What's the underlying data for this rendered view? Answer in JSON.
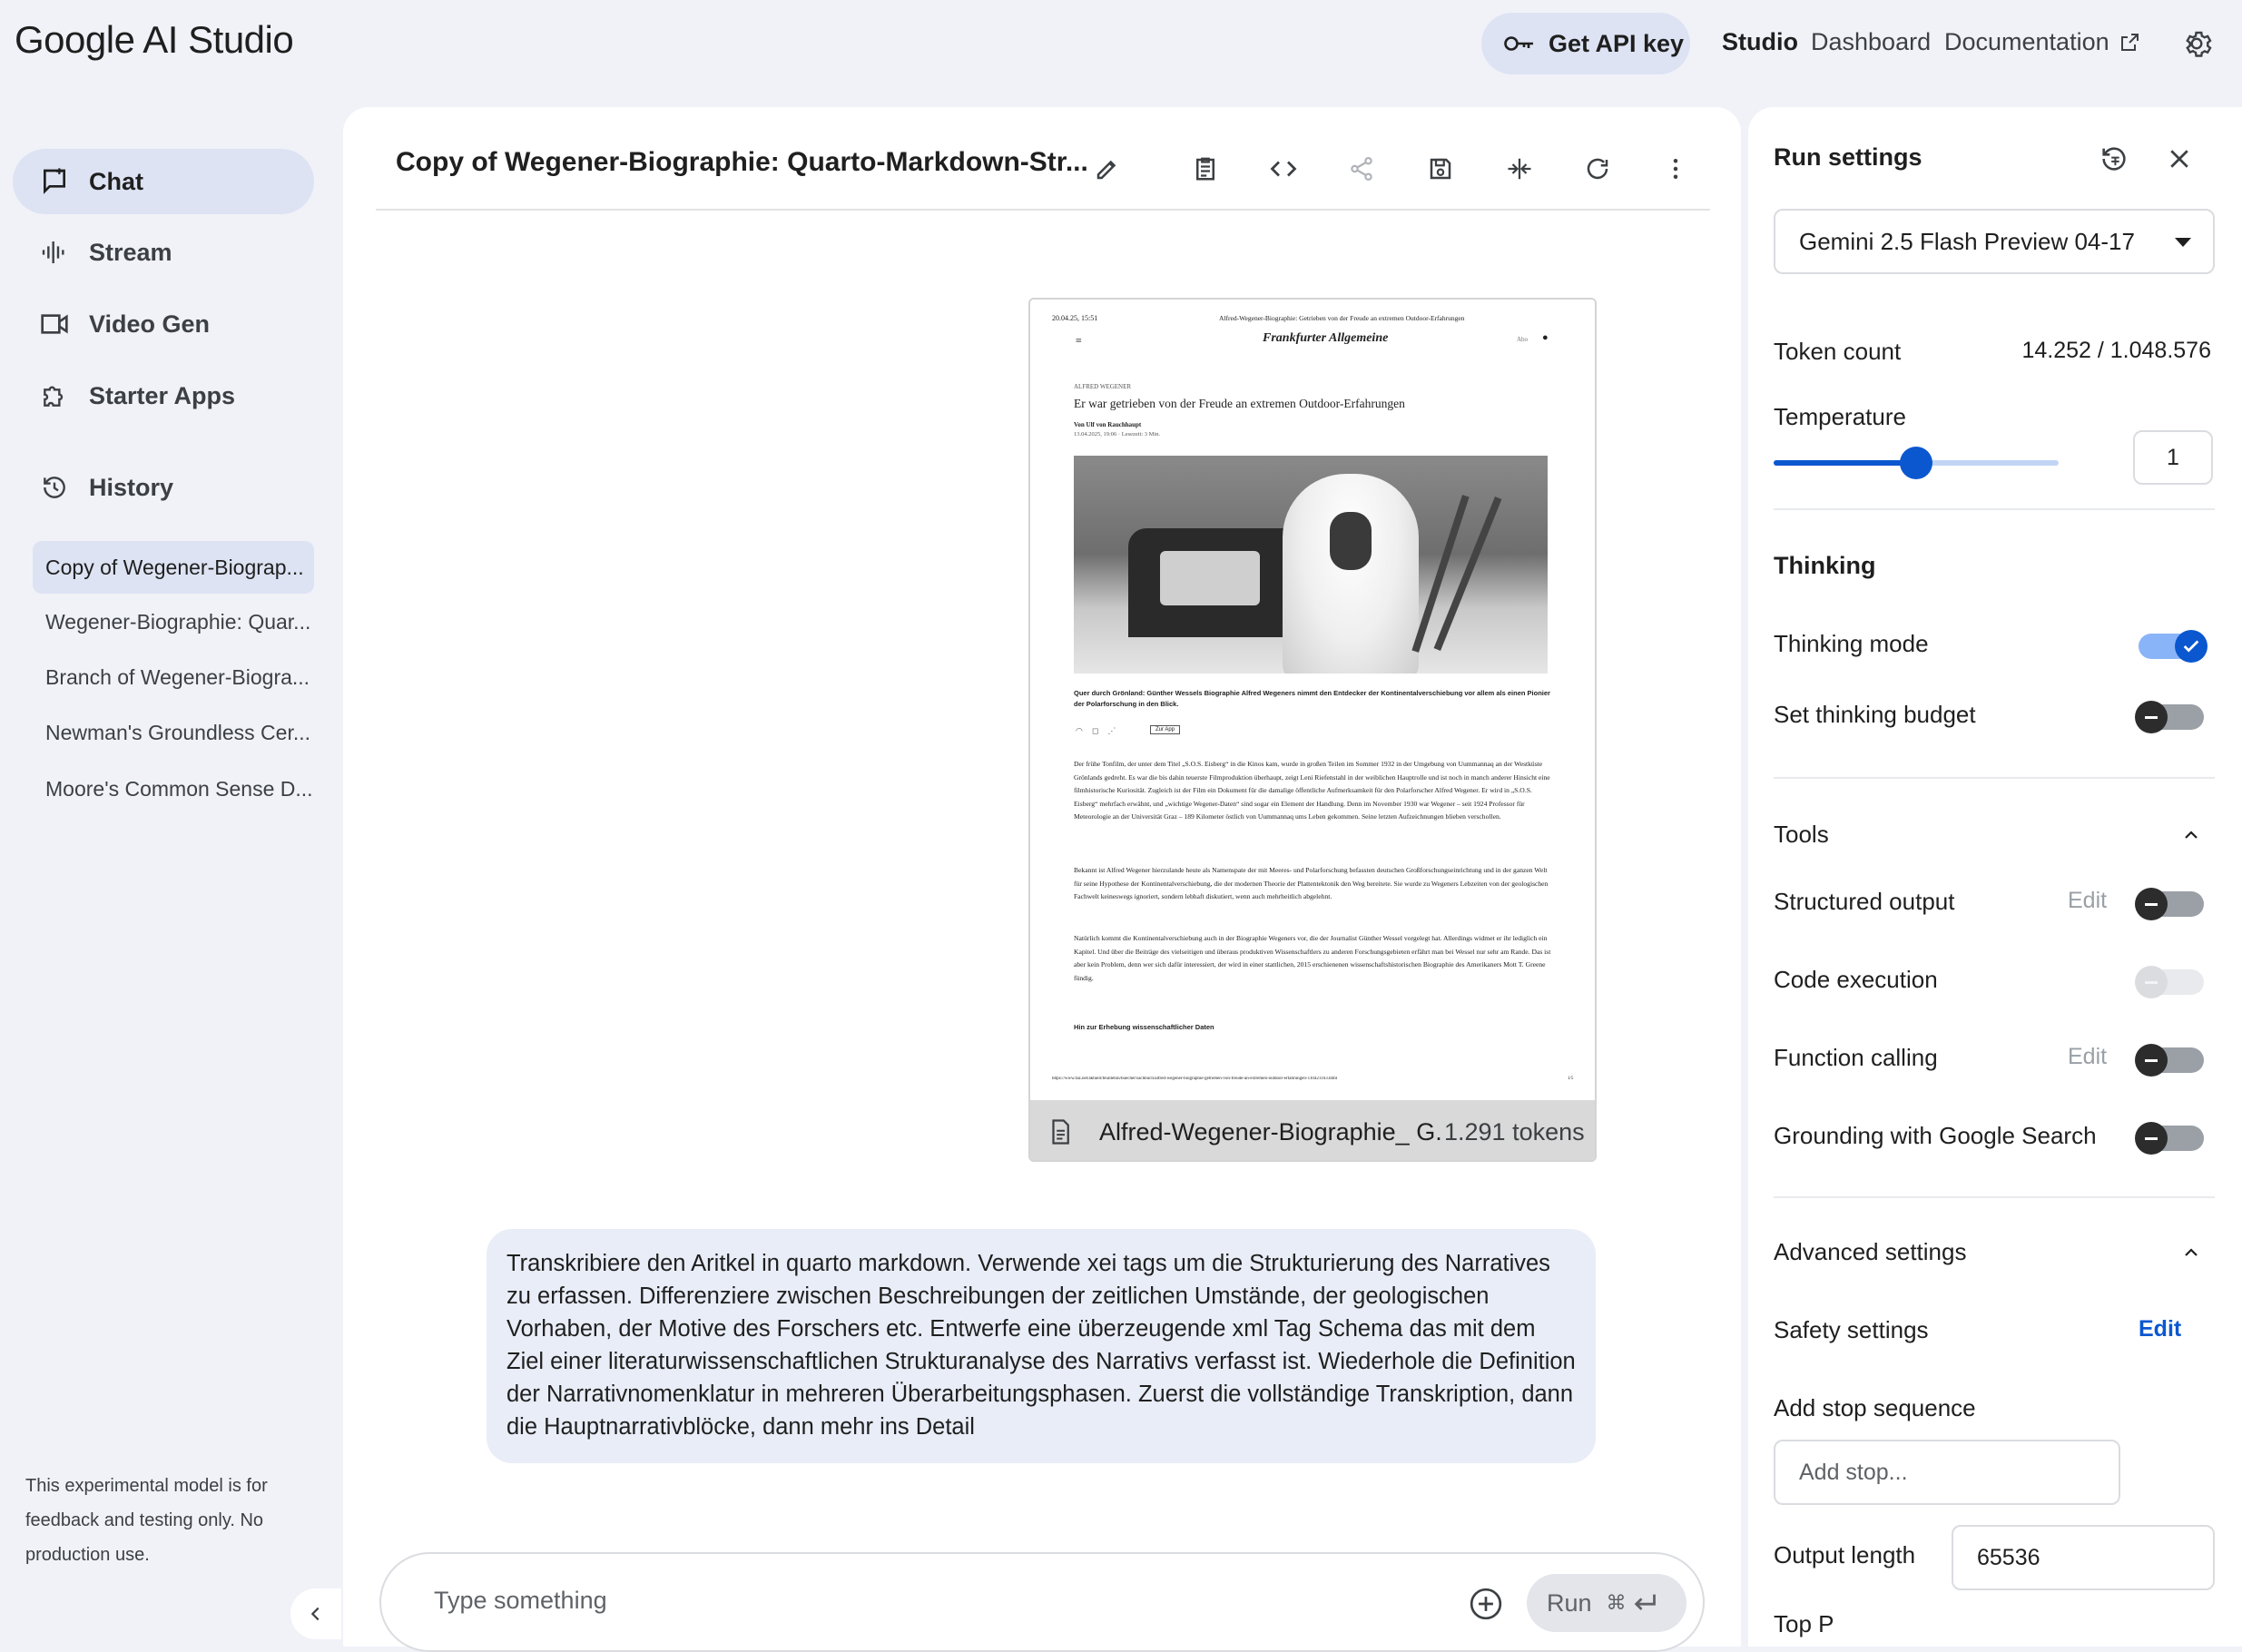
{
  "app": {
    "title": "Google AI Studio"
  },
  "header": {
    "get_api_key": "Get API key",
    "nav": [
      {
        "label": "Studio"
      },
      {
        "label": "Dashboard"
      },
      {
        "label": "Documentation"
      }
    ]
  },
  "sidebar": {
    "items": [
      {
        "label": "Chat",
        "icon": "chat-icon"
      },
      {
        "label": "Stream",
        "icon": "waveform-icon"
      },
      {
        "label": "Video Gen",
        "icon": "video-icon"
      },
      {
        "label": "Starter Apps",
        "icon": "puzzle-icon"
      },
      {
        "label": "History",
        "icon": "history-icon"
      }
    ],
    "history": [
      {
        "label": "Copy of Wegener-Biograp..."
      },
      {
        "label": "Wegener-Biographie: Quar..."
      },
      {
        "label": "Branch of Wegener-Biogra..."
      },
      {
        "label": "Newman's Groundless Cer..."
      },
      {
        "label": "Moore's Common Sense D..."
      }
    ],
    "disclaimer": "This experimental model is for feedback and testing only. No production use."
  },
  "chat": {
    "title": "Copy of Wegener-Biographie: Quarto-Markdown-Str...",
    "attachment": {
      "filename": "Alfred-Wegener-Biographie_ G...",
      "tokens": "1.291 tokens",
      "page": {
        "date": "20.04.25, 15:51",
        "header": "Alfred-Wegener-Biographie: Getrieben von der Freude an extremen Outdoor-Erfahrungen",
        "masthead": "Frankfurter Allgemeine",
        "abo": "Abo",
        "kicker": "ALFRED WEGENER",
        "headline": "Er war getrieben von der Freude an extremen Outdoor-Erfahrungen",
        "author": "Von Ulf von Rauchhaupt",
        "meta": "13.04.2025, 19:06 · Lesezeit: 3 Min.",
        "caption": "Quer durch Grönland: Günther Wessels Biographie Alfred Wegeners nimmt den Entdecker der Kontinentalverschiebung vor allem als einen Pionier der Polarforschung in den Blick.",
        "app_button": "Zur App",
        "p1": "Der frühe Tonfilm, der unter dem Titel „S.O.S. Eisberg“ in die Kinos kam, wurde in großen Teilen im Sommer 1932 in der Umgebung von Uummannaq an der Westküste Grönlands gedreht. Es war die bis dahin teuerste Filmproduktion überhaupt, zeigt Leni Riefenstahl in der weiblichen Hauptrolle und ist noch in manch anderer Hinsicht eine filmhistorische Kuriosität. Zugleich ist der Film ein Dokument für die damalige öffentliche Aufmerksamkeit für den Polarforscher Alfred Wegener. Er wird in „S.O.S. Eisberg“ mehrfach erwähnt, und „wichtige Wegener-Daten“ sind sogar ein Element der Handlung. Denn im November 1930 war Wegener – seit 1924 Professor für Meteorologie an der Universität Graz – 189 Kilometer östlich von Uummannaq ums Leben gekommen. Seine letzten Aufzeichnungen blieben verschollen.",
        "p2": "Bekannt ist Alfred Wegener hierzulande heute als Namenspate der mit Meeres- und Polarforschung befassten deutschen Großforschungseinrichtung und in der ganzen Welt für seine Hypothese der Kontinentalverschiebung, die der modernen Theorie der Plattentektonik den Weg bereitete. Sie wurde zu Wegeners Lebzeiten von der geologischen Fachwelt keineswegs ignoriert, sondern lebhaft diskutiert, wenn auch mehrheitlich abgelehnt.",
        "p3": "Natürlich kommt die Kontinentalverschiebung auch in der Biographie Wegeners vor, die der Journalist Günther Wessel vorgelegt hat. Allerdings widmet er ihr lediglich ein Kapitel. Und über die Beiträge des vielseitigen und überaus produktiven Wissenschaftlers zu anderen Forschungsgebieten erfährt man bei Wessel nur sehr am Rande. Das ist aber kein Problem, denn wer sich dafür interessiert, der wird in einer stattlichen, 2015 erschienenen wissenschaftshistorischen Biographie des Amerikaners Mott T. Greene fündig.",
        "subhead": "Hin zur Erhebung wissenschaftlicher Daten",
        "url": "https://www.faz.net/aktuell/feuilleton/buecher/sachbuch/alfred-wegener-biographie-getrieben-von-freude-an-extremen-outdoor-erfahrungen-110421163.html",
        "page_no": "1/5"
      }
    },
    "message": "Transkribiere den Aritkel in quarto markdown. Verwende xei tags um die Strukturierung des Narratives zu erfassen. Differenziere zwischen Beschreibungen der zeitlichen Umstände, der geologischen Vorhaben, der Motive des Forschers etc. Entwerfe eine überzeugende xml Tag Schema das mit dem Ziel einer literaturwissenschaftlichen Strukturanalyse des Narrativs verfasst ist. Wiederhole die Definition der Narrativnomenklatur in mehreren Überarbeitungsphasen. Zuerst die vollständige Transkription, dann die Hauptnarrativblöcke, dann mehr ins Detail",
    "input_placeholder": "Type something",
    "run_label": "Run",
    "run_shortcut": "⌘"
  },
  "run_settings": {
    "title": "Run settings",
    "model": "Gemini 2.5 Flash Preview 04-17",
    "token_count_label": "Token count",
    "token_count_value": "14.252 / 1.048.576",
    "temperature_label": "Temperature",
    "temperature_value": "1",
    "temperature_fraction": 0.5,
    "thinking_section": "Thinking",
    "thinking_mode": {
      "label": "Thinking mode",
      "on": true
    },
    "thinking_budget": {
      "label": "Set thinking budget",
      "on": false
    },
    "tools_section": "Tools",
    "tools": [
      {
        "label": "Structured output",
        "edit": "Edit",
        "on": false,
        "disabled": false
      },
      {
        "label": "Code execution",
        "edit": "",
        "on": false,
        "disabled": true
      },
      {
        "label": "Function calling",
        "edit": "Edit",
        "on": false,
        "disabled": false
      },
      {
        "label": "Grounding with Google Search",
        "edit": "",
        "on": false,
        "disabled": false
      }
    ],
    "advanced_section": "Advanced settings",
    "safety_label": "Safety settings",
    "safety_edit": "Edit",
    "stop_label": "Add stop sequence",
    "stop_placeholder": "Add stop...",
    "output_length_label": "Output length",
    "output_length_value": "65536",
    "top_p_label": "Top P"
  },
  "colors": {
    "accent": "#0b57d0",
    "chip": "#dde3f3",
    "background": "#f0f2f8"
  }
}
